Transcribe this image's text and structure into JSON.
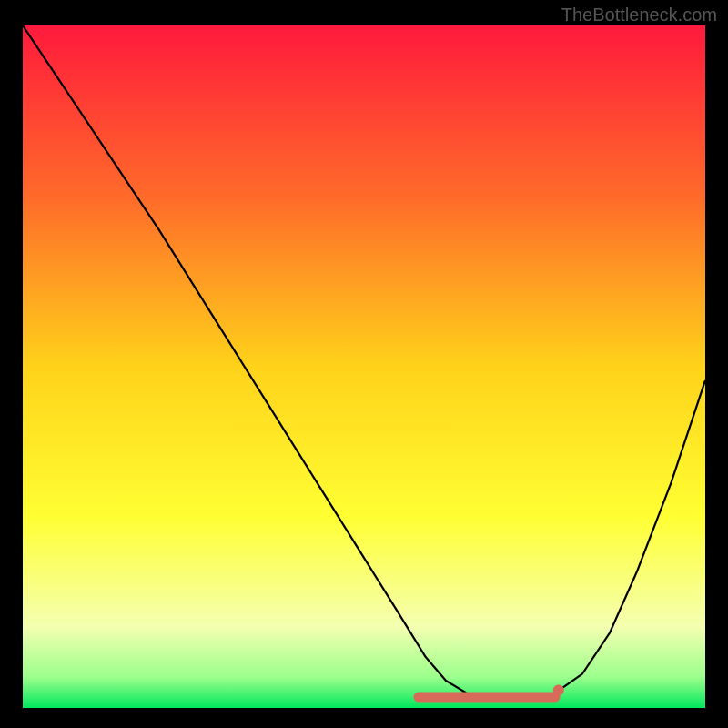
{
  "watermark": "TheBottleneck.com",
  "chart_data": {
    "type": "line",
    "title": "",
    "xlabel": "",
    "ylabel": "",
    "xlim": [
      0,
      100
    ],
    "ylim": [
      0,
      100
    ],
    "gradient_stops": [
      {
        "offset": 0,
        "color": "#ff1a3c"
      },
      {
        "offset": 0.25,
        "color": "#ff6a2a"
      },
      {
        "offset": 0.5,
        "color": "#ffd21a"
      },
      {
        "offset": 0.72,
        "color": "#ffff33"
      },
      {
        "offset": 0.88,
        "color": "#f4ffb0"
      },
      {
        "offset": 0.955,
        "color": "#9cff8c"
      },
      {
        "offset": 1.0,
        "color": "#00e85c"
      }
    ],
    "series": [
      {
        "name": "bottleneck-curve",
        "x": [
          0,
          5,
          10,
          15,
          20,
          25,
          30,
          35,
          40,
          45,
          50,
          55,
          59,
          62,
          65,
          70,
          74,
          78,
          82,
          86,
          90,
          95,
          100
        ],
        "y": [
          100,
          92.5,
          85,
          77.5,
          70,
          62,
          54,
          46,
          38,
          30,
          22,
          14,
          7.5,
          4,
          2.2,
          1.2,
          1.2,
          2.2,
          5,
          11,
          20,
          33,
          48
        ]
      }
    ],
    "highlight_band": {
      "name": "optimal-range",
      "xstart": 58,
      "xend": 78,
      "y": 1.6,
      "color": "#d86a5a"
    },
    "highlight_dot": {
      "x": 78.5,
      "y": 2.6,
      "color": "#d86a5a"
    }
  }
}
